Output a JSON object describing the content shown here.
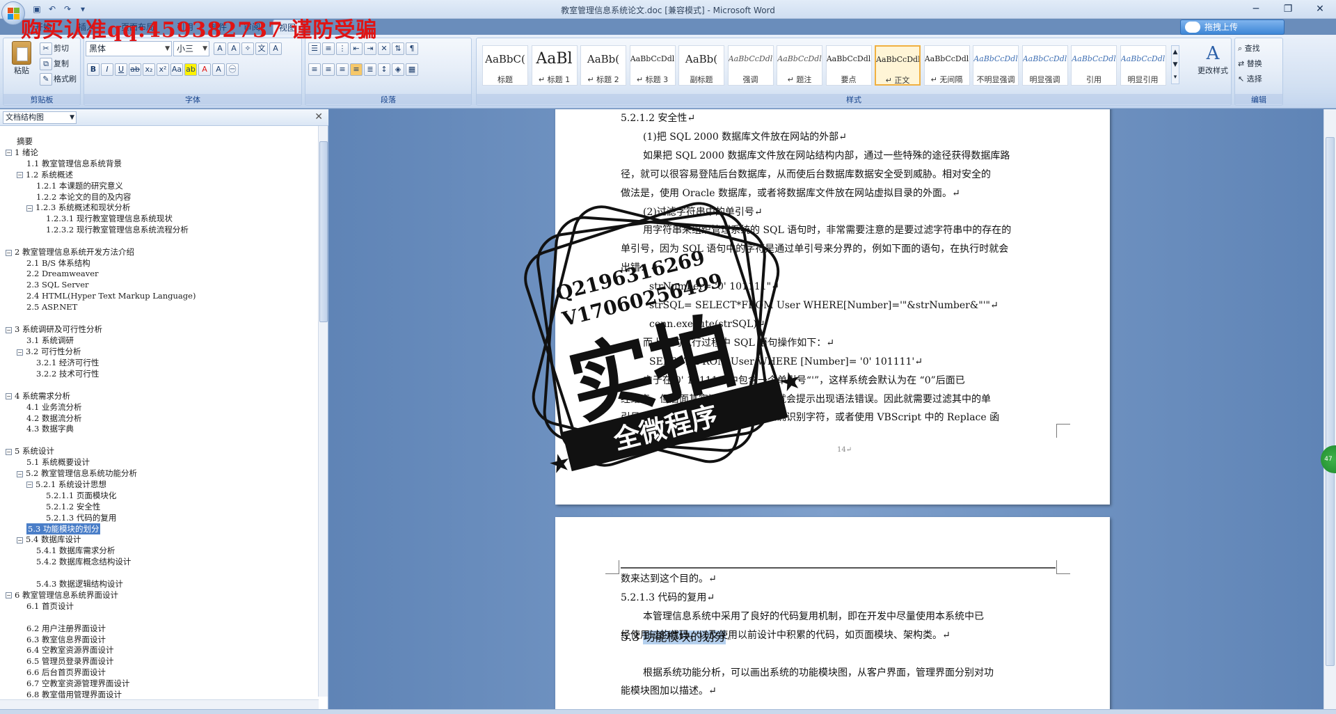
{
  "window": {
    "title": "教室管理信息系统论文.doc [兼容模式] - Microsoft Word",
    "upload_label": "拖拽上传"
  },
  "watermark": {
    "top_text": "购买认准qq:459382737 谨防受骗",
    "stamp_line1": "Q2196316269",
    "stamp_line2": "V17060256499",
    "stamp_big": "实拍",
    "stamp_banner": "全微程序"
  },
  "tabs": [
    "开始",
    "插入",
    "页面布局",
    "引用",
    "邮件",
    "审阅",
    "视图"
  ],
  "ribbon": {
    "clipboard": {
      "label": "剪贴板",
      "paste": "粘贴",
      "cut": "剪切",
      "copy": "复制",
      "format_painter": "格式刷"
    },
    "font": {
      "label": "字体",
      "name": "黑体",
      "size": "小三"
    },
    "paragraph": {
      "label": "段落"
    },
    "styles": {
      "label": "样式",
      "change_styles": "更改样式",
      "items": [
        {
          "sample": "AaBbC(",
          "name": "标题"
        },
        {
          "sample": "AaBl",
          "name": "↵ 标题 1"
        },
        {
          "sample": "AaBb(",
          "name": "↵ 标题 2"
        },
        {
          "sample": "AaBbCcDdl",
          "name": "↵ 标题 3"
        },
        {
          "sample": "AaBb(",
          "name": "副标题"
        },
        {
          "sample": "AaBbCcDdl",
          "name": "强调"
        },
        {
          "sample": "AaBbCcDdl",
          "name": "↵ 题注"
        },
        {
          "sample": "AaBbCcDdl",
          "name": "要点"
        },
        {
          "sample": "AaBbCcDdl",
          "name": "↵ 正文"
        },
        {
          "sample": "AaBbCcDdl",
          "name": "↵ 无间隔"
        },
        {
          "sample": "AaBbCcDdl",
          "name": "不明显强调"
        },
        {
          "sample": "AaBbCcDdl",
          "name": "明显强调"
        },
        {
          "sample": "AaBbCcDdl",
          "name": "引用"
        },
        {
          "sample": "AaBbCcDdl",
          "name": "明显引用"
        }
      ]
    },
    "editing": {
      "label": "编辑",
      "find": "查找",
      "replace": "替换",
      "select": "选择"
    }
  },
  "nav": {
    "selector": "文档结构图",
    "items": [
      {
        "text": "摘要",
        "level": 0,
        "toggle": ""
      },
      {
        "text": "1 绪论",
        "level": 0,
        "toggle": "−"
      },
      {
        "text": "1.1 教室管理信息系统背景",
        "level": 1,
        "toggle": ""
      },
      {
        "text": "1.2 系统概述",
        "level": 1,
        "toggle": "−"
      },
      {
        "text": "1.2.1 本课题的研究意义",
        "level": 2,
        "toggle": ""
      },
      {
        "text": "1.2.2 本论文的目的及内容",
        "level": 2,
        "toggle": ""
      },
      {
        "text": "1.2.3 系统概述和现状分析",
        "level": 2,
        "toggle": "−"
      },
      {
        "text": "1.2.3.1 现行教室管理信息系统现状",
        "level": 3,
        "toggle": ""
      },
      {
        "text": "1.2.3.2 现行教室管理信息系统流程分析",
        "level": 3,
        "toggle": ""
      },
      {
        "text": "",
        "level": 0,
        "toggle": ""
      },
      {
        "text": "2 教室管理信息系统开发方法介绍",
        "level": 0,
        "toggle": "−"
      },
      {
        "text": "2.1 B/S 体系结构",
        "level": 1,
        "toggle": ""
      },
      {
        "text": "2.2 Dreamweaver",
        "level": 1,
        "toggle": ""
      },
      {
        "text": "2.3 SQL Server",
        "level": 1,
        "toggle": ""
      },
      {
        "text": "2.4 HTML(Hyper Text Markup Language)",
        "level": 1,
        "toggle": ""
      },
      {
        "text": "2.5 ASP.NET",
        "level": 1,
        "toggle": ""
      },
      {
        "text": "",
        "level": 0,
        "toggle": ""
      },
      {
        "text": "3 系统调研及可行性分析",
        "level": 0,
        "toggle": "−"
      },
      {
        "text": "3.1 系统调研",
        "level": 1,
        "toggle": ""
      },
      {
        "text": "3.2 可行性分析",
        "level": 1,
        "toggle": "−"
      },
      {
        "text": "3.2.1 经济可行性",
        "level": 2,
        "toggle": ""
      },
      {
        "text": "3.2.2 技术可行性",
        "level": 2,
        "toggle": ""
      },
      {
        "text": "",
        "level": 0,
        "toggle": ""
      },
      {
        "text": "4 系统需求分析",
        "level": 0,
        "toggle": "−"
      },
      {
        "text": "4.1 业务流分析",
        "level": 1,
        "toggle": ""
      },
      {
        "text": "4.2 数据流分析",
        "level": 1,
        "toggle": ""
      },
      {
        "text": "4.3 数据字典",
        "level": 1,
        "toggle": ""
      },
      {
        "text": "",
        "level": 0,
        "toggle": ""
      },
      {
        "text": "5 系统设计",
        "level": 0,
        "toggle": "−"
      },
      {
        "text": "5.1 系统概要设计",
        "level": 1,
        "toggle": ""
      },
      {
        "text": "5.2 教室管理信息系统功能分析",
        "level": 1,
        "toggle": "−"
      },
      {
        "text": "5.2.1 系统设计思想",
        "level": 2,
        "toggle": "−"
      },
      {
        "text": "5.2.1.1 页面模块化",
        "level": 3,
        "toggle": ""
      },
      {
        "text": "5.2.1.2 安全性",
        "level": 3,
        "toggle": ""
      },
      {
        "text": "5.2.1.3 代码的复用",
        "level": 3,
        "toggle": ""
      },
      {
        "text": "5.3 功能模块的划分",
        "level": 1,
        "toggle": "",
        "selected": true
      },
      {
        "text": "5.4 数据库设计",
        "level": 1,
        "toggle": "−"
      },
      {
        "text": "5.4.1 数据库需求分析",
        "level": 2,
        "toggle": ""
      },
      {
        "text": "5.4.2 数据库概念结构设计",
        "level": 2,
        "toggle": ""
      },
      {
        "text": "",
        "level": 0,
        "toggle": ""
      },
      {
        "text": "5.4.3 数据逻辑结构设计",
        "level": 2,
        "toggle": ""
      },
      {
        "text": "6 教室管理信息系统界面设计",
        "level": 0,
        "toggle": "−"
      },
      {
        "text": "6.1 首页设计",
        "level": 1,
        "toggle": ""
      },
      {
        "text": "",
        "level": 0,
        "toggle": ""
      },
      {
        "text": "6.2 用户注册界面设计",
        "level": 1,
        "toggle": ""
      },
      {
        "text": "6.3 教室信息界面设计",
        "level": 1,
        "toggle": ""
      },
      {
        "text": "6.4 空教室资源界面设计",
        "level": 1,
        "toggle": ""
      },
      {
        "text": "6.5 管理员登录界面设计",
        "level": 1,
        "toggle": ""
      },
      {
        "text": "6.6 后台首页界面设计",
        "level": 1,
        "toggle": ""
      },
      {
        "text": "6.7 空教室资源管理界面设计",
        "level": 1,
        "toggle": ""
      },
      {
        "text": "6.8 教室借用管理界面设计",
        "level": 1,
        "toggle": ""
      }
    ]
  },
  "page1": {
    "lines": [
      {
        "text": "5.2.1.2 安全性↵",
        "cls": "head"
      },
      {
        "text": "(1)把 SQL 2000 数据库文件放在网站的外部↵",
        "cls": "indent"
      },
      {
        "text": "如果把 SQL 2000 数据库文件放在网站结构内部，通过一些特殊的途径获得数据库路",
        "cls": "indent"
      },
      {
        "text": "径，就可以很容易登陆后台数据库，从而使后台数据库数据安全受到威胁。相对安全的",
        "cls": ""
      },
      {
        "text": "做法是，使用 Oracle 数据库，或者将数据库文件放在网站虚拟目录的外面。↵",
        "cls": ""
      },
      {
        "text": "(2)过滤字符串中的单引号↵",
        "cls": "indent"
      },
      {
        "text": "用字符串来组织管理系统的 SQL 语句时，非常需要注意的是要过滤字符串中的存在的",
        "cls": "indent"
      },
      {
        "text": "单引号，因为 SQL 语句中的字符是通过单引号来分界的，例如下面的语句，在执行时就会",
        "cls": ""
      },
      {
        "text": "出错：↵",
        "cls": ""
      },
      {
        "text": "strNumber= '0' 101111\"↵",
        "cls": "indent3"
      },
      {
        "text": "strSQL= SELECT*FROM User WHERE[Number]='\"&strNumber&\"'\"↵",
        "cls": "indent3"
      },
      {
        "text": "conn.execute(strSQL)↵",
        "cls": "indent3"
      },
      {
        "text": "而上面的执行过程中 SQL 语句操作如下：↵",
        "cls": "indent"
      },
      {
        "text": "SELECT*FROM User WHERE [Number]= '0' 101111'↵",
        "cls": "indent3"
      },
      {
        "text": "由于在'0' 101111\"中包含一个单引号“'”，这样系统会默认为在 “0”后面已",
        "cls": "indent"
      },
      {
        "text": "经结束，但后面其实还有字符，于是就会提示出现语法错误。因此就需要过滤其中的单",
        "cls": ""
      },
      {
        "text": "引号，或者使用两个单引号让系统正确识别字符，或者使用 VBScript 中的 Replace 函",
        "cls": ""
      }
    ],
    "page_number": "14↵"
  },
  "page2": {
    "lines": [
      {
        "text": "数来达到这个目的。↵",
        "cls": ""
      },
      {
        "text": "5.2.1.3 代码的复用↵",
        "cls": "head"
      },
      {
        "text": "本管理信息系统中采用了良好的代码复用机制，即在开发中尽量使用本系统中已",
        "cls": "indent"
      },
      {
        "text": "经使用过的代码，以及使用以前设计中积累的代码，如页面模块、架构类。↵",
        "cls": ""
      },
      {
        "text": "",
        "cls": "h2"
      },
      {
        "text": "根据系统功能分析，可以画出系统的功能模块图，从客户界面，管理界面分别对功",
        "cls": "indent"
      },
      {
        "text": "能模块图加以描述。↵",
        "cls": ""
      }
    ],
    "heading_num": "5.3 ",
    "heading_text": "功能模块的划分",
    "heading_mark": "↵"
  },
  "colors": {
    "accent": "#4a7ec8",
    "watermark": "#e01414",
    "desktop": "#6a8dbb"
  }
}
